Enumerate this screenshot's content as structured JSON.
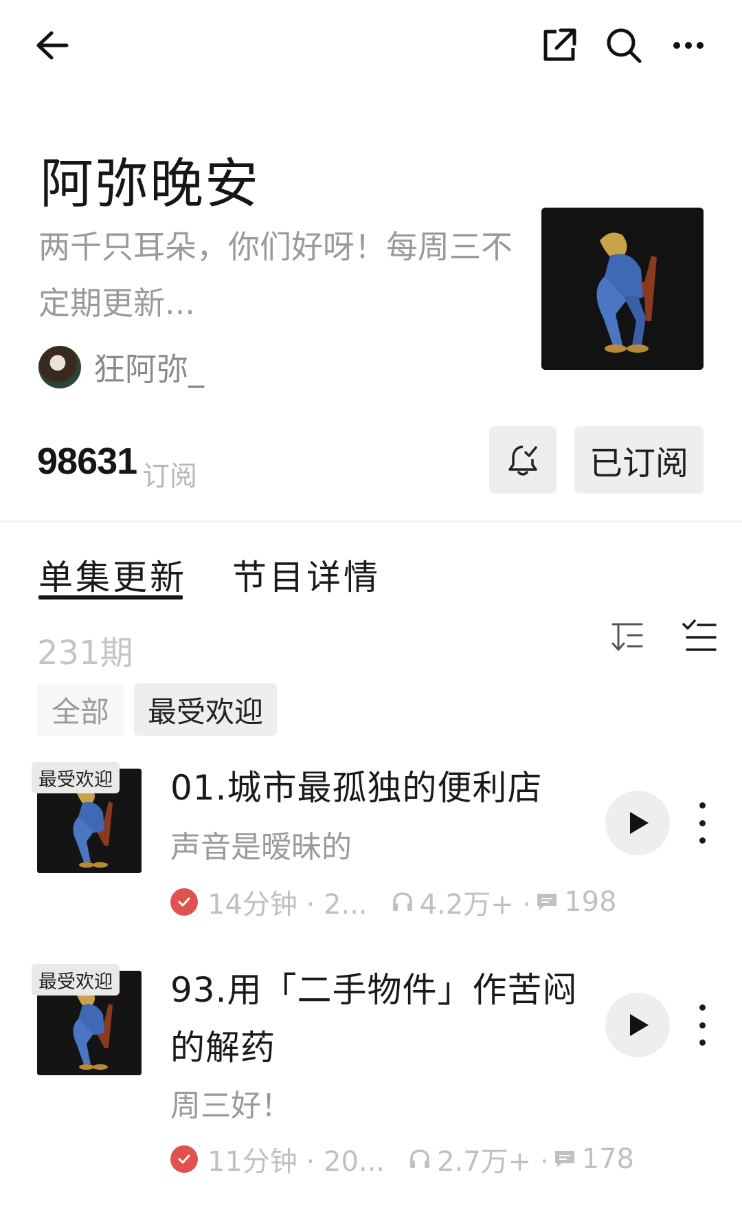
{
  "topbar": {
    "back_icon": "arrow-left-icon",
    "share_icon": "share-icon",
    "search_icon": "search-icon",
    "more_icon": "more-icon"
  },
  "show": {
    "title": "阿弥晚安",
    "description": "两千只耳朵，你们好呀！每周三不定期更新...",
    "author": "狂阿弥_",
    "subscribers": "98631",
    "subscribers_label": "订阅",
    "subscribed_label": "已订阅"
  },
  "tabs": [
    {
      "label": "单集更新",
      "active": true
    },
    {
      "label": "节目详情",
      "active": false
    }
  ],
  "episode_count": "231期",
  "filters": [
    {
      "label": "全部",
      "selected": false
    },
    {
      "label": "最受欢迎",
      "selected": true
    }
  ],
  "episodes": [
    {
      "badge": "最受欢迎",
      "title": "01.城市最孤独的便利店",
      "subtitle": "声音是暧昧的",
      "duration": "14分钟 · 2...",
      "plays": "4.2万+ ·",
      "comments": "198"
    },
    {
      "badge": "最受欢迎",
      "title": "93.用「二手物件」作苦闷的解药",
      "subtitle": "周三好！",
      "duration": "11分钟 · 20...",
      "plays": "2.7万+ ·",
      "comments": "178"
    }
  ],
  "colors": {
    "accent_check": "#e0524f",
    "text_primary": "#1a1a1a",
    "text_secondary": "#9a9a9a",
    "button_bg": "#eeeeee"
  }
}
